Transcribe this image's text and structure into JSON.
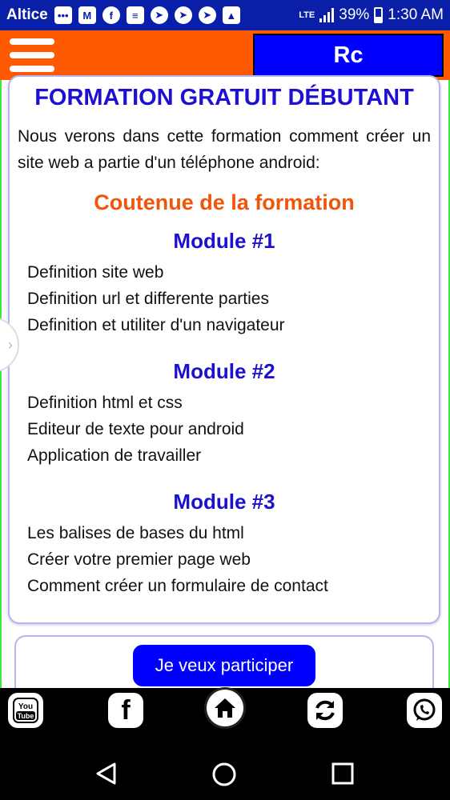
{
  "status_bar": {
    "carrier": "Altice",
    "network": "LTE",
    "battery": "39%",
    "time": "1:30 AM",
    "icons": [
      "chat-icon",
      "gmail-icon",
      "facebook-icon",
      "stack-icon",
      "telegram-icon",
      "telegram-icon",
      "telegram-icon",
      "image-icon"
    ]
  },
  "header": {
    "brand": "Rc"
  },
  "card": {
    "title": "FORMATION GRATUIT DÉBUTANT",
    "intro": "Nous verons dans cette formation comment créer un site web a partie d'un téléphone android:",
    "section_title": "Coutenue de la formation",
    "modules": [
      {
        "title": "Module #1",
        "items": [
          "Definition site web",
          "Definition url et differente parties",
          "Definition et utiliter d'un navigateur"
        ]
      },
      {
        "title": "Module #2",
        "items": [
          "Definition html et css",
          "Editeur de texte pour android",
          "Application de travailler"
        ]
      },
      {
        "title": "Module #3",
        "items": [
          "Les balises de bases du html",
          "Créer votre premier page web",
          "Comment créer un formulaire de contact"
        ]
      }
    ]
  },
  "cta": {
    "label": "Je veux participer"
  },
  "bottom_bar": {
    "youtube_label": "You Tube",
    "facebook_label": "f",
    "icons": [
      "youtube-icon",
      "facebook-icon",
      "home-icon",
      "refresh-icon",
      "whatsapp-icon"
    ]
  },
  "colors": {
    "status_bar": "#0a1fa8",
    "app_bar": "#ff5a00",
    "brand_button": "#0000ff",
    "title_blue": "#1e10d0",
    "section_orange": "#f0550a",
    "cta_button": "#0000ff"
  }
}
